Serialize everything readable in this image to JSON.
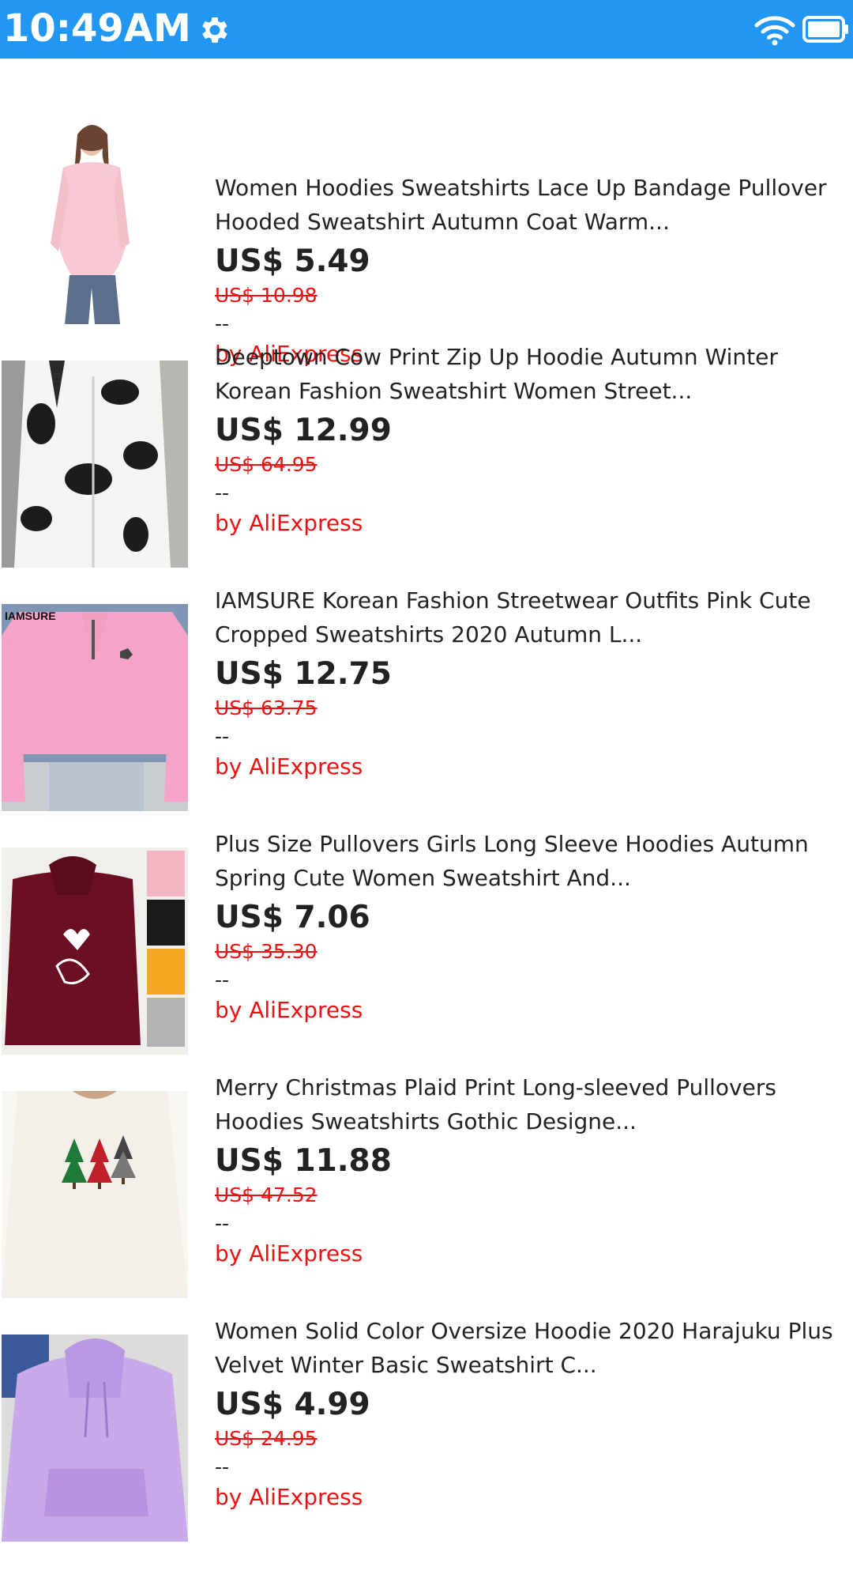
{
  "status_bar": {
    "time": "10:49AM",
    "background_color": "#2196f3",
    "icons": [
      "gear-icon",
      "wifi-icon",
      "battery-icon"
    ]
  },
  "products": [
    {
      "title": "Women Hoodies Sweatshirts Lace Up Bandage Pullover Hooded Sweatshirt Autumn Coat Warm...",
      "price": "US$ 5.49",
      "original_price": "US$ 10.98",
      "rating": "--",
      "seller": "by AliExpress",
      "image": "pink-hoodie-photo"
    },
    {
      "title": "Deeptown Cow Print Zip Up Hoodie Autumn Winter Korean Fashion Sweatshirt Women Street...",
      "price": "US$ 12.99",
      "original_price": "US$ 64.95",
      "rating": "--",
      "seller": "by AliExpress",
      "image": "cow-print-hoodie-photo"
    },
    {
      "title": "IAMSURE Korean Fashion Streetwear Outfits Pink Cute Cropped Sweatshirts 2020 Autumn L...",
      "price": "US$ 12.75",
      "original_price": "US$ 63.75",
      "rating": "--",
      "seller": "by AliExpress",
      "image": "pink-cropped-sweatshirt-photo",
      "image_text": "IAMSURE"
    },
    {
      "title": "Plus Size Pullovers Girls Long Sleeve Hoodies Autumn Spring Cute Women Sweatshirt And...",
      "price": "US$ 7.06",
      "original_price": "US$ 35.30",
      "rating": "--",
      "seller": "by AliExpress",
      "image": "burgundy-hoodie-photo"
    },
    {
      "title": "Merry Christmas Plaid Print Long-sleeved Pullovers Hoodies Sweatshirts Gothic Designe...",
      "price": "US$ 11.88",
      "original_price": "US$ 47.52",
      "rating": "--",
      "seller": "by AliExpress",
      "image": "christmas-tree-sweatshirt-photo"
    },
    {
      "title": "Women Solid Color Oversize Hoodie 2020 Harajuku Plus Velvet Winter Basic Sweatshirt C...",
      "price": "US$ 4.99",
      "original_price": "US$ 24.95",
      "rating": "--",
      "seller": "by AliExpress",
      "image": "purple-hoodie-photo"
    }
  ]
}
